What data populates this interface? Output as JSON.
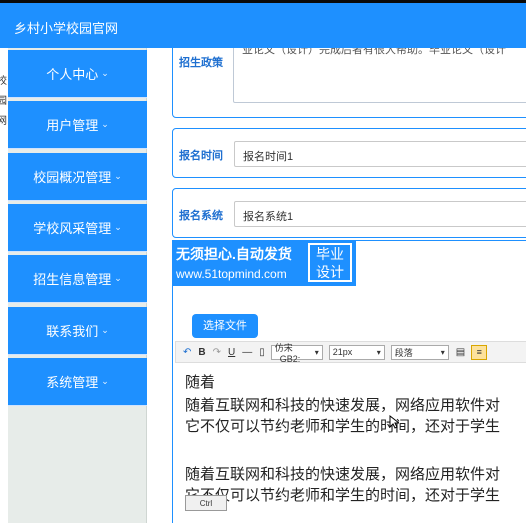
{
  "header": {
    "site_title": "乡村小学校园官网"
  },
  "left_strip": [
    "校",
    "园",
    "网"
  ],
  "sidebar": {
    "items": [
      {
        "label": "个人中心"
      },
      {
        "label": "用户管理"
      },
      {
        "label": "校园概况管理"
      },
      {
        "label": "学校风采管理"
      },
      {
        "label": "招生信息管理"
      },
      {
        "label": "联系我们"
      },
      {
        "label": "系统管理"
      }
    ],
    "caret": "⌄"
  },
  "form": {
    "policy_label": "招生政策",
    "policy_value": "业论文（设计）完成后者有很大帮助。毕业论文（设计",
    "time_label": "报名时间",
    "time_value": "报名时间1",
    "system_label": "报名系统",
    "system_value": "报名系统1"
  },
  "banner": {
    "line1": "无须担心.自动发货",
    "line2": "www.51topmind.com",
    "badge": "毕业\n设计"
  },
  "upload_button": "选择文件",
  "toolbar": {
    "undo": "↶",
    "bold": "B",
    "redo": "↷",
    "underline": "U",
    "hr": "—",
    "font": "仿宋_GB2:",
    "size": "21px",
    "paragraph": "段落",
    "ordered": "≡"
  },
  "editor": {
    "lines": [
      "随着",
      "随着互联网和科技的快速发展，网络应用软件对",
      "它不仅可以节约老师和学生的时间，还对于学生",
      "随着互联网和科技的快速发展，网络应用软件对",
      "它不仅可以节约老师和学生的时间，还对于学生"
    ],
    "chip": "Ctrl"
  }
}
